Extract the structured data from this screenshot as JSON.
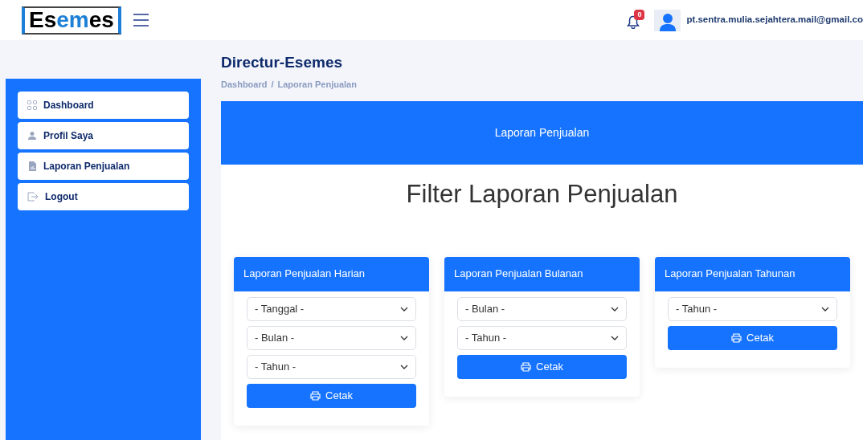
{
  "header": {
    "logo": "Esemes",
    "notification_count": "0",
    "user_email": "pt.sentra.mulia.sejahtera.mail@gmail.co"
  },
  "sidebar": {
    "items": [
      {
        "label": "Dashboard"
      },
      {
        "label": "Profil Saya"
      },
      {
        "label": "Laporan Penjualan"
      },
      {
        "label": "Logout"
      }
    ]
  },
  "page": {
    "title": "Directur-Esemes",
    "breadcrumb": [
      "Dashboard",
      "Laporan Penjualan"
    ],
    "breadcrumb_separator": "/"
  },
  "banner": {
    "title": "Laporan Penjualan"
  },
  "heading": "Filter Laporan Penjualan",
  "cards": [
    {
      "title": "Laporan Penjualan Harian",
      "selects": [
        "- Tanggal -",
        "- Bulan -",
        "- Tahun -"
      ],
      "button": "Cetak"
    },
    {
      "title": "Laporan Penjualan Bulanan",
      "selects": [
        "- Bulan -",
        "- Tahun -"
      ],
      "button": "Cetak"
    },
    {
      "title": "Laporan Penjualan Tahunan",
      "selects": [
        "- Tahun -"
      ],
      "button": "Cetak"
    }
  ]
}
